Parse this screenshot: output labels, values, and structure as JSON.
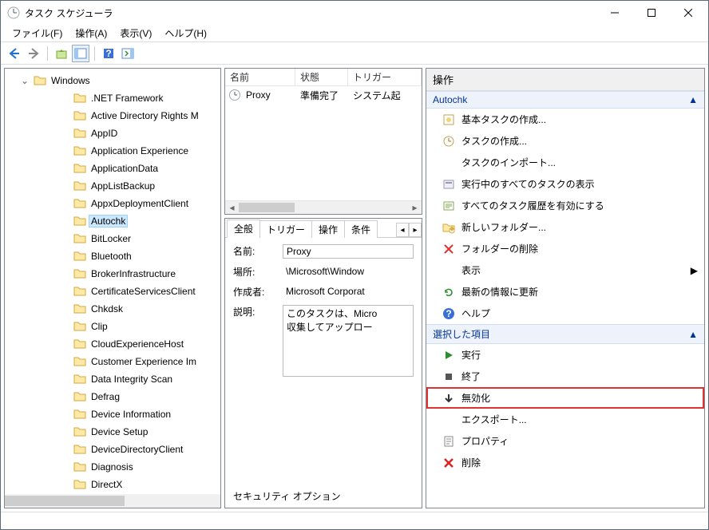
{
  "title": "タスク スケジューラ",
  "menus": {
    "file": "ファイル(F)",
    "action": "操作(A)",
    "view": "表示(V)",
    "help": "ヘルプ(H)"
  },
  "tree": {
    "root": "Windows",
    "items": [
      ".NET Framework",
      "Active Directory Rights M",
      "AppID",
      "Application Experience",
      "ApplicationData",
      "AppListBackup",
      "AppxDeploymentClient",
      "Autochk",
      "BitLocker",
      "Bluetooth",
      "BrokerInfrastructure",
      "CertificateServicesClient",
      "Chkdsk",
      "Clip",
      "CloudExperienceHost",
      "Customer Experience Im",
      "Data Integrity Scan",
      "Defrag",
      "Device Information",
      "Device Setup",
      "DeviceDirectoryClient",
      "Diagnosis",
      "DirectX"
    ],
    "selected": "Autochk"
  },
  "list": {
    "columns": {
      "name": "名前",
      "status": "状態",
      "trigger": "トリガー"
    },
    "rows": [
      {
        "name": "Proxy",
        "status": "準備完了",
        "trigger": "システム起"
      }
    ]
  },
  "detail": {
    "tabs": {
      "general": "全般",
      "triggers": "トリガー",
      "actions": "操作",
      "conditions": "条件"
    },
    "fields": {
      "name_label": "名前:",
      "name_value": "Proxy",
      "location_label": "場所:",
      "location_value": "\\Microsoft\\Window",
      "author_label": "作成者:",
      "author_value": "Microsoft Corporat",
      "desc_label": "説明:",
      "desc_value": "このタスクは、Micro\n収集してアップロー"
    },
    "security_title": "セキュリティ オプション"
  },
  "actions": {
    "header": "操作",
    "group1_title": "Autochk",
    "group1": [
      {
        "icon": "task-basic-icon",
        "label": "基本タスクの作成..."
      },
      {
        "icon": "task-create-icon",
        "label": "タスクの作成..."
      },
      {
        "icon": "blank-icon",
        "label": "タスクのインポート..."
      },
      {
        "icon": "running-icon",
        "label": "実行中のすべてのタスクの表示"
      },
      {
        "icon": "history-icon",
        "label": "すべてのタスク履歴を有効にする"
      },
      {
        "icon": "folder-new-icon",
        "label": "新しいフォルダー..."
      },
      {
        "icon": "delete-x-icon",
        "label": "フォルダーの削除"
      },
      {
        "icon": "blank-icon",
        "label": "表示",
        "arrow": true
      },
      {
        "icon": "refresh-icon",
        "label": "最新の情報に更新"
      },
      {
        "icon": "help-icon",
        "label": "ヘルプ"
      }
    ],
    "group2_title": "選択した項目",
    "group2": [
      {
        "icon": "run-icon",
        "label": "実行"
      },
      {
        "icon": "stop-icon",
        "label": "終了"
      },
      {
        "icon": "disable-icon",
        "label": "無効化",
        "highlight": true
      },
      {
        "icon": "blank-icon",
        "label": "エクスポート..."
      },
      {
        "icon": "props-icon",
        "label": "プロパティ"
      },
      {
        "icon": "delete-red-icon",
        "label": "削除"
      }
    ]
  }
}
